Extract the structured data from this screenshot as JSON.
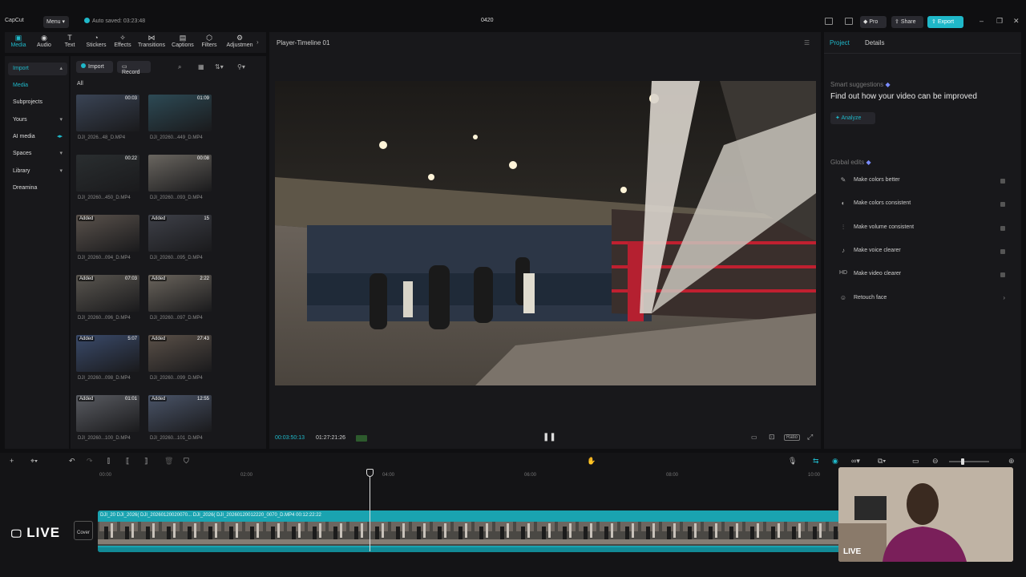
{
  "app": {
    "logo": "CapCut",
    "menu_label": "Menu",
    "autosave": "Auto saved: 03:23:48",
    "project_title": "0420",
    "pro_label": "Pro",
    "share_label": "Share",
    "export_label": "Export"
  },
  "toolbar": {
    "items": [
      {
        "label": "Media",
        "icon": "media-icon"
      },
      {
        "label": "Audio",
        "icon": "audio-icon"
      },
      {
        "label": "Text",
        "icon": "text-icon"
      },
      {
        "label": "Stickers",
        "icon": "sticker-icon"
      },
      {
        "label": "Effects",
        "icon": "effects-icon"
      },
      {
        "label": "Transitions",
        "icon": "transitions-icon"
      },
      {
        "label": "Captions",
        "icon": "captions-icon"
      },
      {
        "label": "Filters",
        "icon": "filters-icon"
      },
      {
        "label": "Adjustmen",
        "icon": "adjustment-icon"
      }
    ]
  },
  "nav": {
    "items": [
      "Import",
      "Media",
      "Subprojects",
      "Yours",
      "AI media",
      "Spaces",
      "Library",
      "Dreamina"
    ]
  },
  "media": {
    "import_label": "Import",
    "record_label": "Record",
    "filter_label": "All",
    "items": [
      {
        "name": "DJI_2026...48_D.MP4",
        "duration": "00:03",
        "added": ""
      },
      {
        "name": "DJI_20260...449_D.MP4",
        "duration": "01:09",
        "added": ""
      },
      {
        "name": "DJI_20260...450_D.MP4",
        "duration": "00:22",
        "added": ""
      },
      {
        "name": "DJI_20260...093_D.MP4",
        "duration": "00:08",
        "added": ""
      },
      {
        "name": "DJI_20260...094_D.MP4",
        "duration": "",
        "added": "Added"
      },
      {
        "name": "DJI_20260...095_D.MP4",
        "duration": "15",
        "added": "Added"
      },
      {
        "name": "DJI_20260...096_D.MP4",
        "duration": "07:03",
        "added": "Added"
      },
      {
        "name": "DJI_20260...097_D.MP4",
        "duration": "2:22",
        "added": "Added"
      },
      {
        "name": "DJI_20260...098_D.MP4",
        "duration": "5:07",
        "added": "Added"
      },
      {
        "name": "DJI_20260...099_D.MP4",
        "duration": "27:43",
        "added": "Added"
      },
      {
        "name": "DJI_20260...100_D.MP4",
        "duration": "01:01",
        "added": "Added"
      },
      {
        "name": "DJI_20260...101_D.MP4",
        "duration": "12:55",
        "added": "Added"
      }
    ]
  },
  "player": {
    "title": "Player-Timeline 01",
    "current_time": "00:03:50:13",
    "total_time": "01:27:21:26",
    "ratio_label": "Ratio"
  },
  "right_panel": {
    "tabs": [
      "Project",
      "Details"
    ],
    "smart_label": "Smart suggestions",
    "smart_title": "Find out how your video can be improved",
    "analyze_label": "Analyze",
    "global_label": "Global edits",
    "edits": [
      {
        "label": "Make colors better",
        "icon": "wand-icon"
      },
      {
        "label": "Make colors consistent",
        "icon": "palette-icon"
      },
      {
        "label": "Make volume consistent",
        "icon": "volume-bars-icon"
      },
      {
        "label": "Make voice clearer",
        "icon": "voice-icon"
      },
      {
        "label": "Make video clearer",
        "icon": "hd-icon"
      },
      {
        "label": "Retouch face",
        "icon": "face-icon"
      }
    ]
  },
  "timeline": {
    "ticks": [
      "00:00",
      "02:00",
      "04:00",
      "06:00",
      "08:00",
      "10:00"
    ],
    "track_labels": "DJI_20  DJI_2026(  DJI_20260120020070...  DJI_2026(  DJI_20260120012220_0070_D.MP4   00:12:22:22",
    "cover_label": "Cover",
    "live_label": "LIVE"
  },
  "webcam": {
    "live_label": "LIVE"
  },
  "colors": {
    "accent": "#1fb8c9",
    "track": "#1aa3b0",
    "panel": "#18181b",
    "bg": "#0f0f11"
  }
}
